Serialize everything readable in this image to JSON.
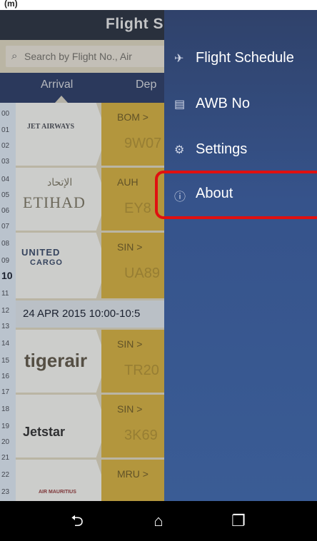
{
  "caption": "(m)",
  "header": {
    "title": "Flight S"
  },
  "search": {
    "placeholder": "Search by Flight No., Air"
  },
  "tabs": [
    {
      "label": "Arrival"
    },
    {
      "label": "Dep"
    }
  ],
  "hours": [
    "00",
    "01",
    "02",
    "03",
    "04",
    "05",
    "06",
    "07",
    "08",
    "09",
    "10",
    "11",
    "12",
    "13",
    "14",
    "15",
    "16",
    "17",
    "18",
    "19",
    "20",
    "21",
    "22",
    "23"
  ],
  "rows": [
    {
      "airline": "JET AIRWAYS",
      "route": "BOM >",
      "flight": "9W07"
    },
    {
      "airline_ar": "الإتحاد",
      "airline": "ETIHAD",
      "route": "AUH",
      "flight": "EY8"
    },
    {
      "airline": "UNITED",
      "airline2": "CARGO",
      "route": "SIN >",
      "flight": "UA89"
    },
    {
      "airline": "tigerair",
      "route": "SIN >",
      "flight": "TR20"
    },
    {
      "airline": "Jetstar",
      "route": "SIN >",
      "flight": "3K69"
    },
    {
      "airline": "AIR MAURITIUS",
      "route": "MRU >",
      "flight": ""
    }
  ],
  "date_row": {
    "text": "24 APR 2015 10:00-10:5"
  },
  "drawer": {
    "items": [
      {
        "label": "Flight Schedule",
        "icon": "plane-icon"
      },
      {
        "label": "AWB No",
        "icon": "document-icon"
      },
      {
        "label": "Settings",
        "icon": "gear-icon"
      },
      {
        "label": "About",
        "icon": "info-icon"
      }
    ],
    "highlighted": "About"
  },
  "colors": {
    "drawer": "#36538b",
    "gold": "#c7a540",
    "highlight": "#e01010"
  }
}
